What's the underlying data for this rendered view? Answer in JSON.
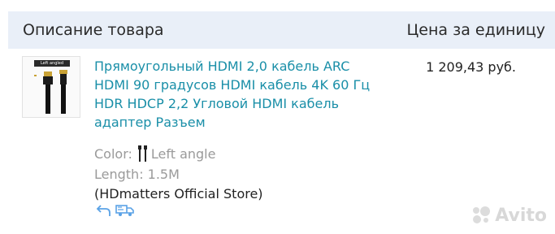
{
  "table_header": {
    "description": "Описание товара",
    "unit_price": "Цена за единицу"
  },
  "item": {
    "thumb_label": "Left angled",
    "title": "Прямоугольный HDMI 2,0 кабель ARC HDMI 90 градусов HDMI кабель 4K 60 Гц HDR HDCP 2,2 Угловой HDMI кабель адаптер Разъем",
    "price": "1 209,43 руб.",
    "color_label": "Color:",
    "color_value": "Left angle",
    "length": "Length: 1.5M",
    "store": "(HDmatters Official Store)",
    "icons": [
      "return-icon",
      "delivery-truck-icon"
    ]
  },
  "watermark": "Avito",
  "colors": {
    "header_bg": "#e9eff8",
    "link": "#1a8fa8",
    "muted": "#9a9a9a",
    "icon": "#5aa2e6"
  }
}
